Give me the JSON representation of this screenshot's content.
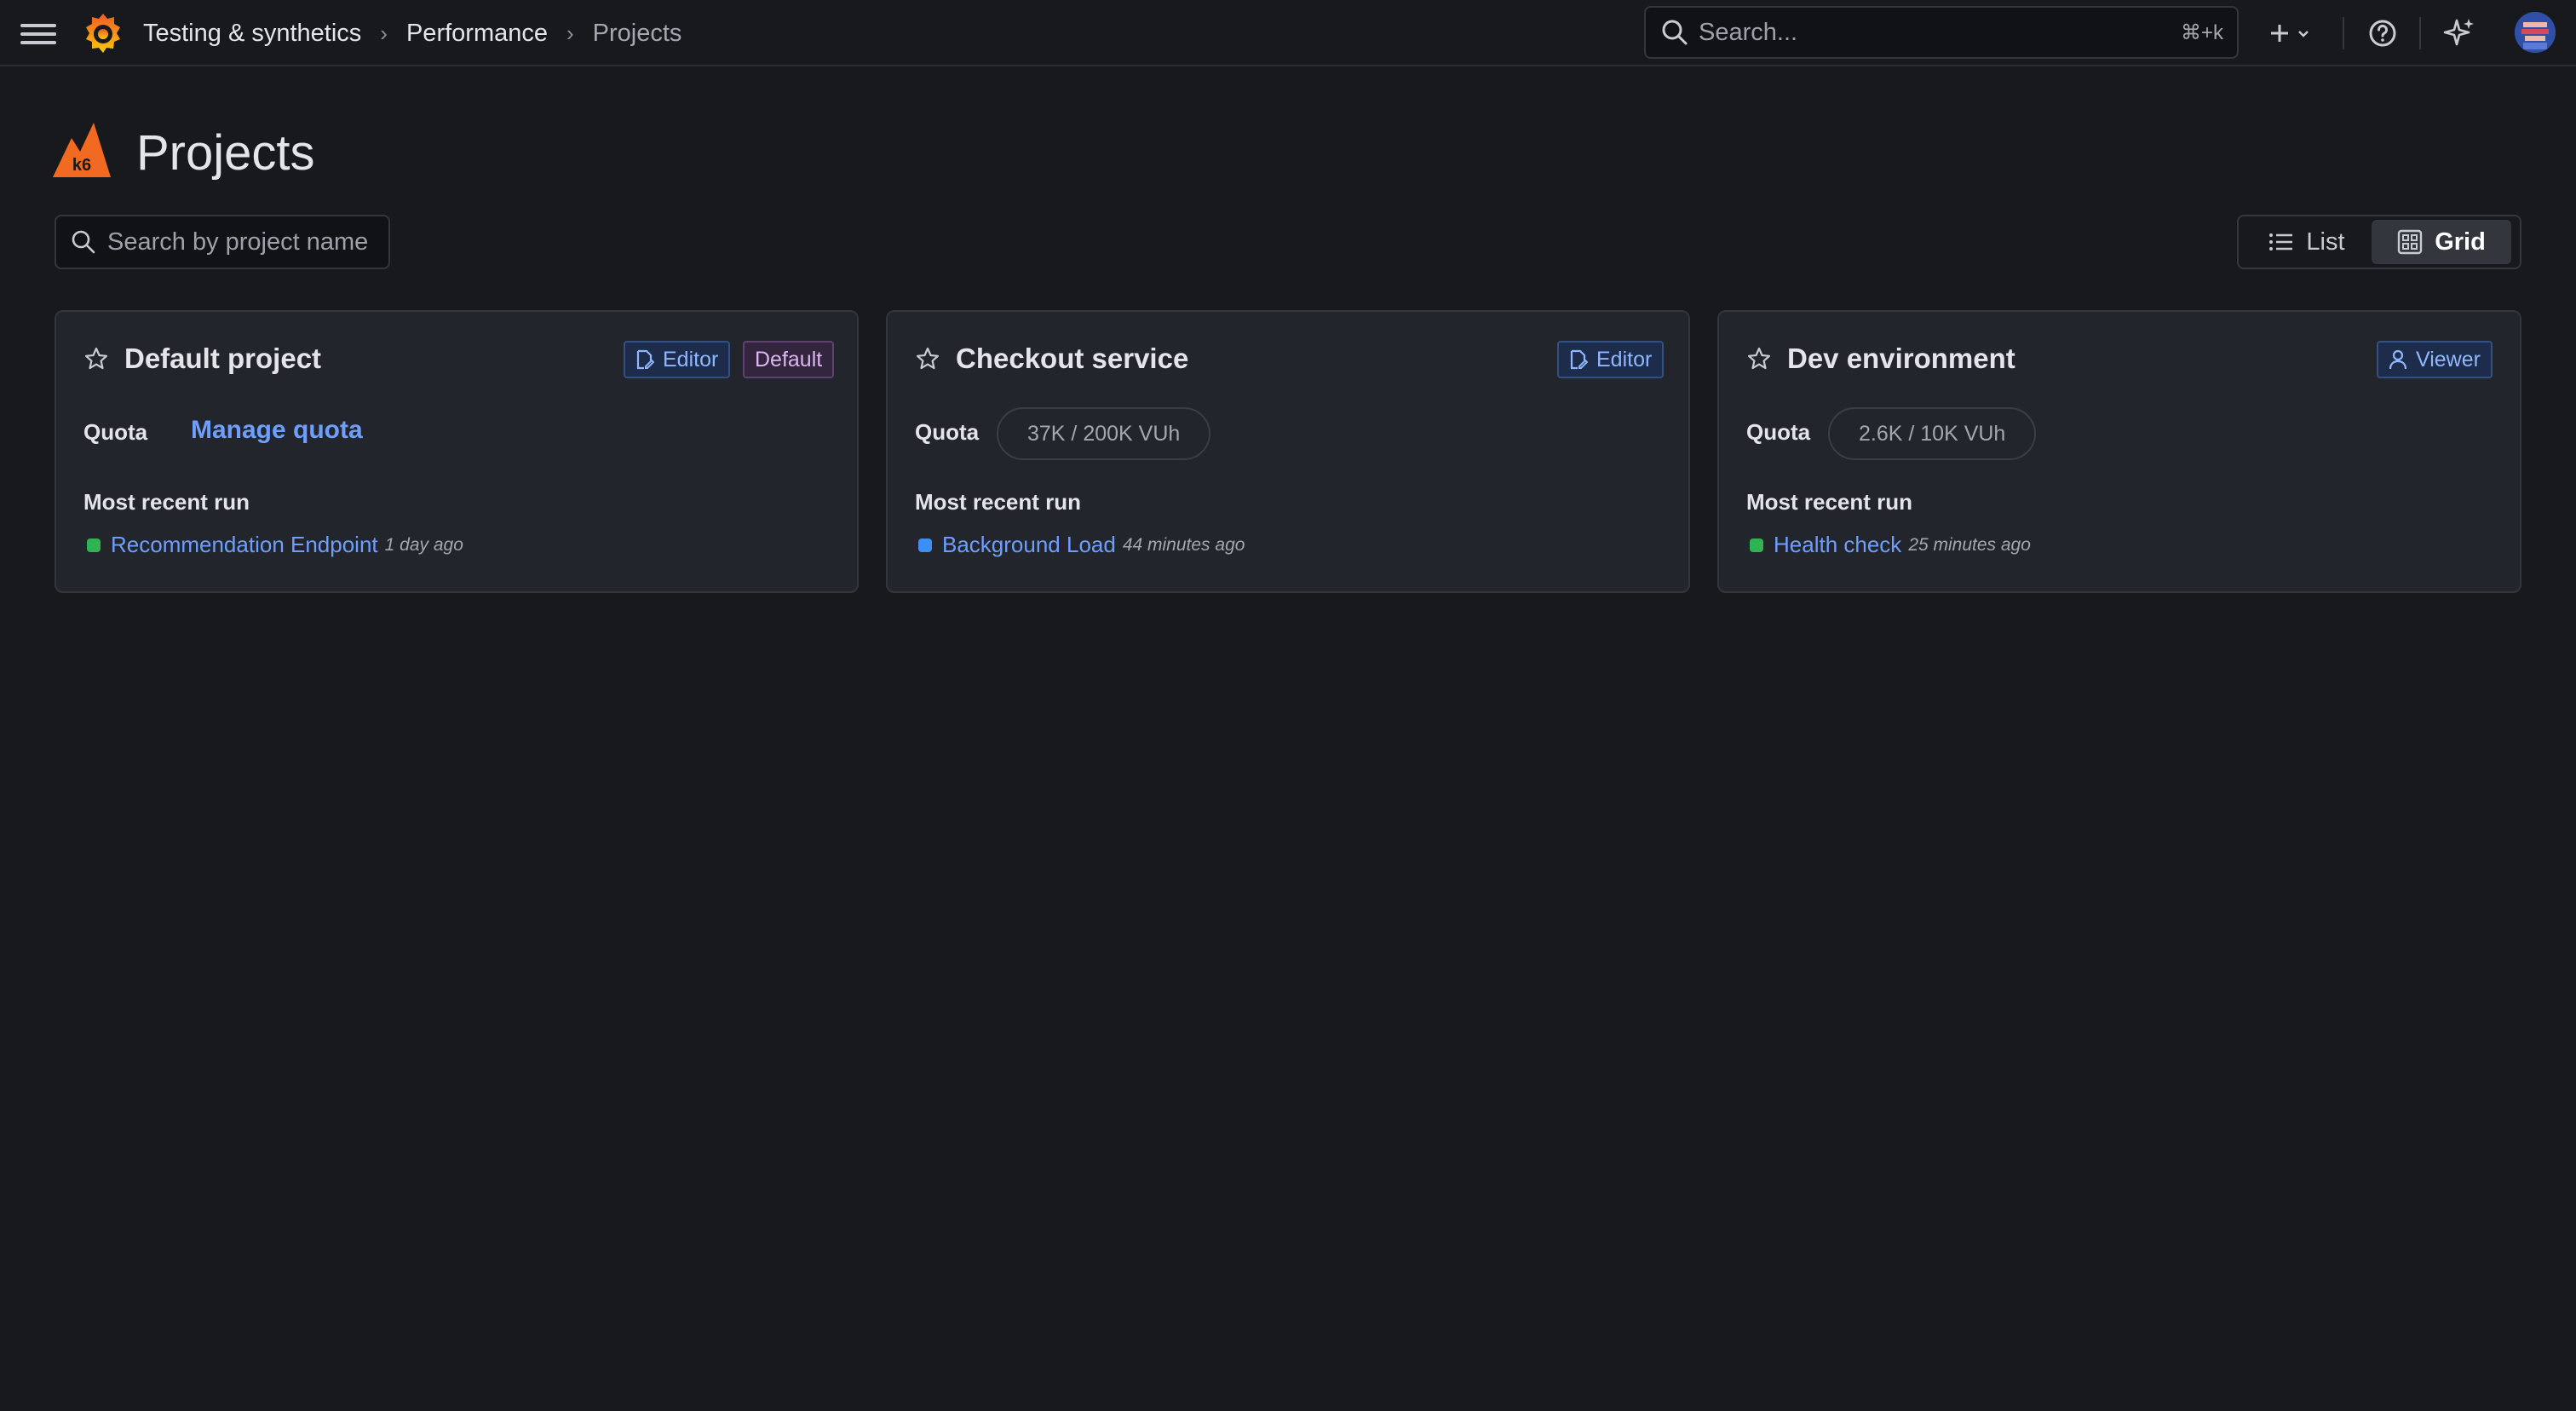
{
  "topbar": {
    "breadcrumbs": [
      "Testing & synthetics",
      "Performance",
      "Projects"
    ],
    "search_placeholder": "Search...",
    "search_shortcut": "⌘+k"
  },
  "header": {
    "title": "Projects",
    "search_placeholder": "Search by project name",
    "view_options": [
      "List",
      "Grid"
    ],
    "active_view": "Grid"
  },
  "cards": [
    {
      "name": "Default project",
      "role": "Editor",
      "default_badge": "Default",
      "quota_label": "Quota",
      "quota_link": "Manage quota",
      "recent_label": "Most recent run",
      "run_name": "Recommendation Endpoint",
      "run_time": "1 day ago",
      "run_status_color": "#2fb451"
    },
    {
      "name": "Checkout service",
      "role": "Editor",
      "quota_label": "Quota",
      "quota_value": "37K / 200K VUh",
      "recent_label": "Most recent run",
      "run_name": "Background Load",
      "run_time": "44 minutes ago",
      "run_status_color": "#3d8ef5"
    },
    {
      "name": "Dev environment",
      "role": "Viewer",
      "quota_label": "Quota",
      "quota_value": "2.6K / 10K VUh",
      "recent_label": "Most recent run",
      "run_name": "Health check",
      "run_time": "25 minutes ago",
      "run_status_color": "#2fb451"
    }
  ],
  "colors": {
    "background": "#18191d",
    "card": "#22252b",
    "link": "#6e9fff",
    "grafana_orange": "#f46800",
    "k6_orange": "#f26a21"
  },
  "icons": [
    "menu-icon",
    "grafana-logo",
    "search-icon",
    "plus-icon",
    "chevron-down-icon",
    "help-icon",
    "sparkle-icon",
    "k6-logo",
    "list-icon",
    "grid-icon",
    "star-icon",
    "edit-doc-icon",
    "user-icon"
  ]
}
